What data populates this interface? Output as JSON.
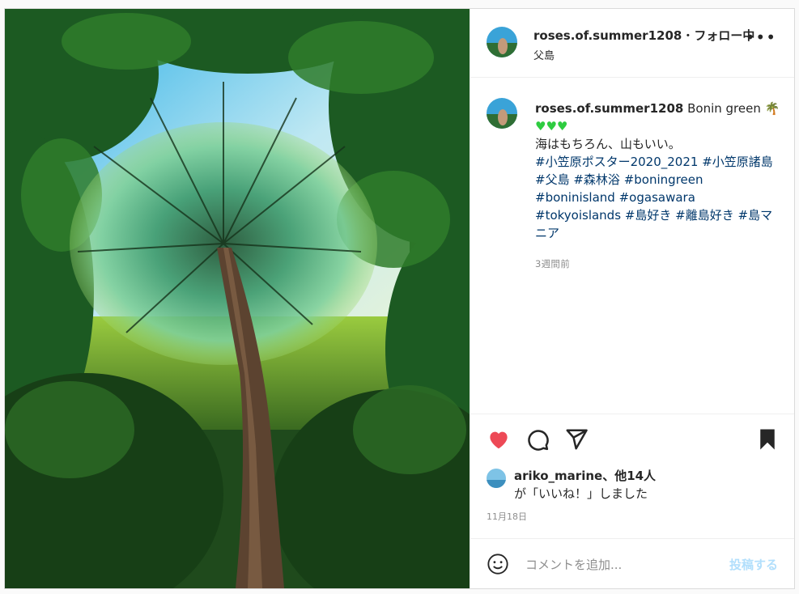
{
  "post": {
    "username": "roses.of.summer1208",
    "separator": "・",
    "follow_status": "フォロー中",
    "location": "父島",
    "more_label": "•••",
    "caption": {
      "text_1": "Bonin green",
      "text_2": "海はもちろん、山もいい。",
      "hashtags": [
        "#小笠原ポスター2020_2021",
        "#小笠原諸島",
        "#父島",
        "#森林浴",
        "#boningreen",
        "#boninisland",
        "#ogasawara",
        "#tokyoislands",
        "#島好き",
        "#離島好き",
        "#島マニア"
      ],
      "time_ago": "3週間前"
    },
    "likes": {
      "liker": "ariko_marine",
      "others": "、他14人",
      "suffix": "が「いいね！」しました"
    },
    "date": "11月18日",
    "comment": {
      "placeholder": "コメントを追加...",
      "post_label": "投稿する"
    }
  },
  "icons": {
    "like": "heart-icon",
    "comment": "comment-icon",
    "share": "share-icon",
    "save": "bookmark-icon",
    "emoji": "emoji-icon",
    "more": "more-icon"
  },
  "colors": {
    "like_red": "#ed4956",
    "hashtag_blue": "#00376b",
    "post_button_disabled": "#b2dffc",
    "text": "#262626",
    "secondary": "#8e8e8e"
  }
}
